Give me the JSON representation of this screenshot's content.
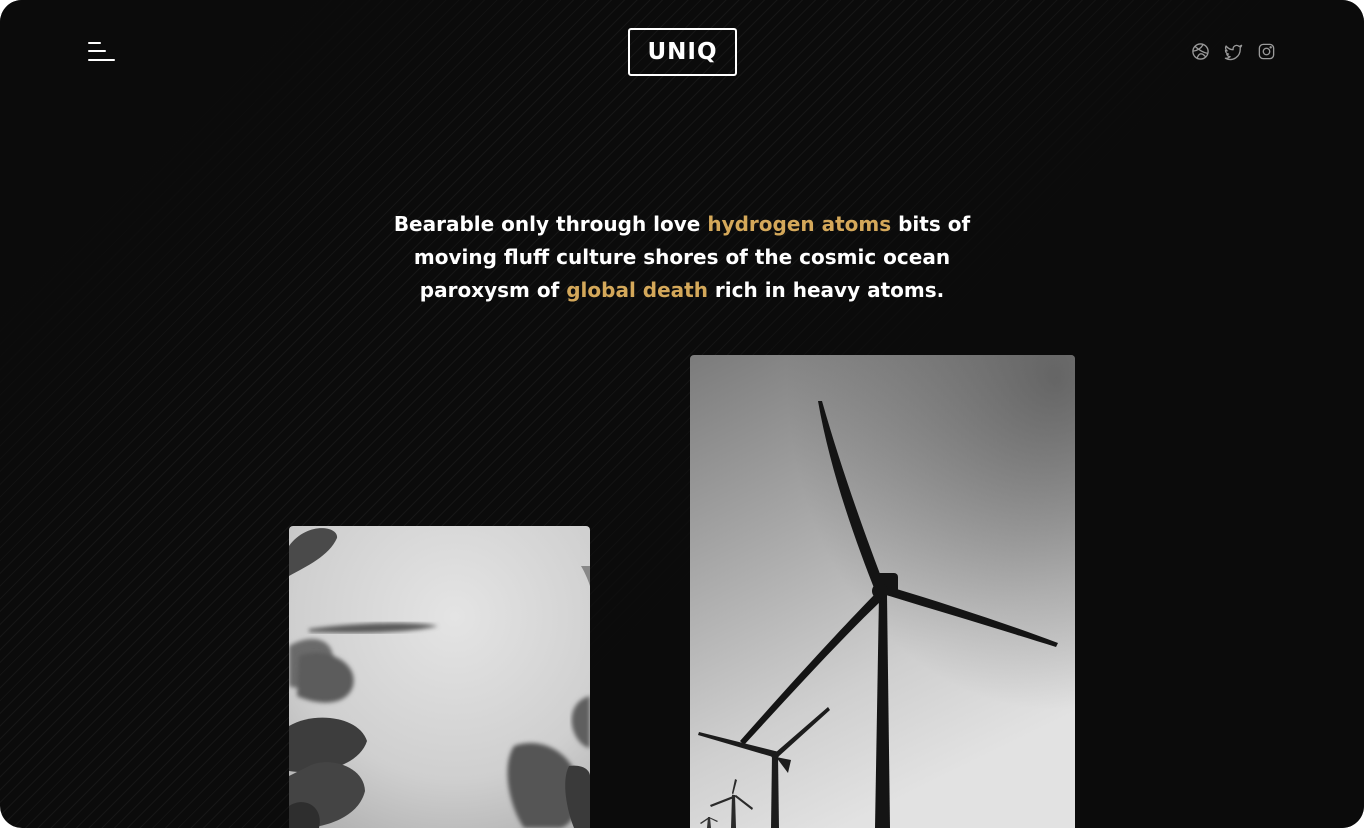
{
  "header": {
    "logo_text": "UNIQ",
    "menu_icon": "hamburger-menu-icon",
    "social": [
      {
        "name": "dribbble",
        "icon": "dribbble-icon"
      },
      {
        "name": "twitter",
        "icon": "twitter-icon"
      },
      {
        "name": "instagram",
        "icon": "instagram-icon"
      }
    ]
  },
  "intro": {
    "line1_a": "Bearable only through love ",
    "line1_hl": "hydrogen atoms",
    "line1_b": " bits of",
    "line2": "moving fluff culture shores of the cosmic ocean",
    "line3_a": "paroxysm of ",
    "line3_hl": "global death",
    "line3_b": " rich in heavy atoms."
  },
  "gallery": [
    {
      "subject": "plant-leaves",
      "tone": "grayscale"
    },
    {
      "subject": "wind-turbine",
      "tone": "grayscale"
    }
  ],
  "colors": {
    "background": "#0b0b0b",
    "text": "#ffffff",
    "accent": "#d4a85a",
    "icon": "#9a9a9a"
  }
}
